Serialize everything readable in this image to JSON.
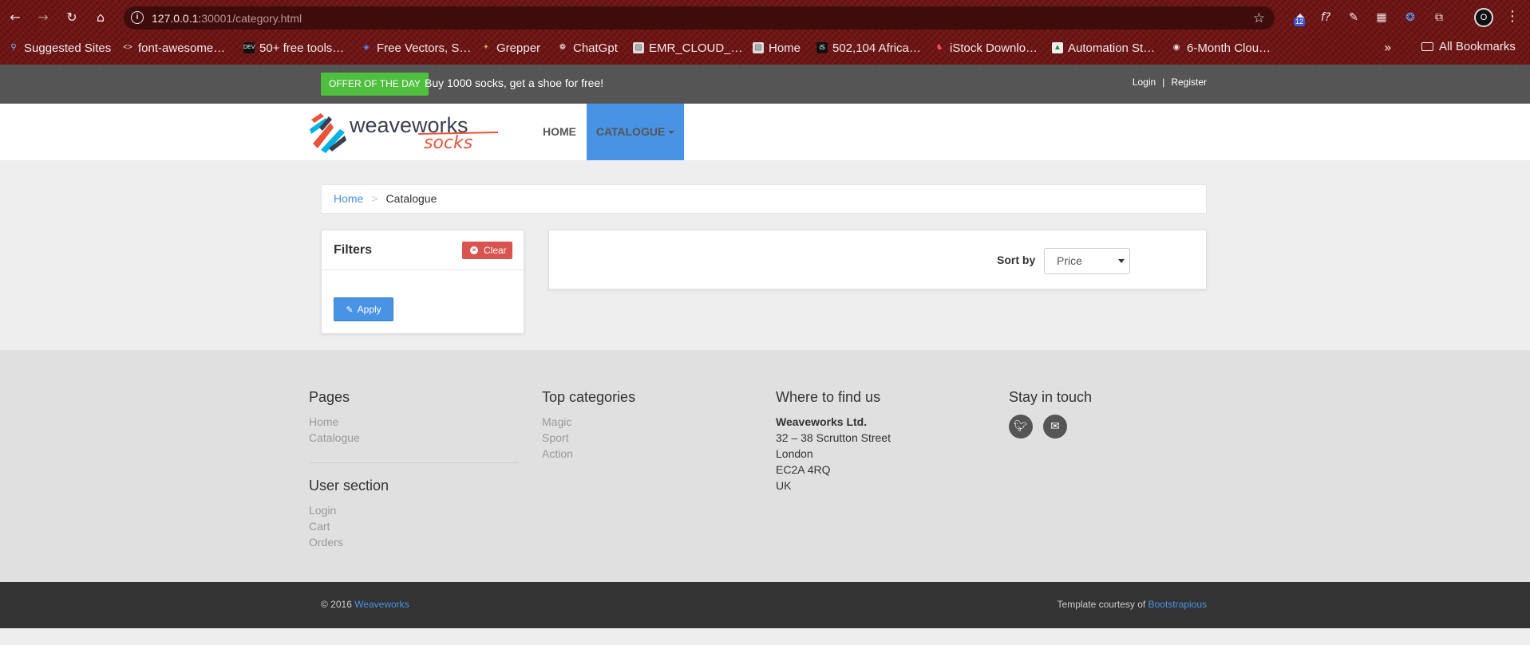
{
  "browser": {
    "url_host": "127.0.0.1:",
    "url_rest": "30001/category.html",
    "extension_badge": "12",
    "profile_initial": "O",
    "bookmarks": [
      {
        "label": "Suggested Sites",
        "icon": "search-icon"
      },
      {
        "label": "font-awesome…",
        "icon": "code-icon"
      },
      {
        "label": "50+ free tools…",
        "icon": "dev-icon"
      },
      {
        "label": "Free Vectors, S…",
        "icon": "shield-icon"
      },
      {
        "label": "Grepper",
        "icon": "grepper-icon"
      },
      {
        "label": "ChatGpt",
        "icon": "chatgpt-icon"
      },
      {
        "label": "EMR_CLOUD_…",
        "icon": "image-icon"
      },
      {
        "label": "Home",
        "icon": "image-icon"
      },
      {
        "label": "502,104 Africa…",
        "icon": "istock-icon"
      },
      {
        "label": "iStock Downlo…",
        "icon": "istock-icon"
      },
      {
        "label": "Automation St…",
        "icon": "triangle-icon"
      },
      {
        "label": "6-Month Clou…",
        "icon": "github-icon"
      }
    ],
    "all_bookmarks": "All Bookmarks"
  },
  "topbar": {
    "offer_badge": "OFFER OF THE DAY",
    "offer_text": "Buy 1000 socks, get a shoe for free!",
    "login": "Login",
    "separator": "|",
    "register": "Register"
  },
  "header": {
    "logo_main": "weaveworks",
    "logo_sub": "socks",
    "nav_home": "HOME",
    "nav_catalogue": "CATALOGUE"
  },
  "breadcrumb": {
    "home": "Home",
    "separator": ">",
    "current": "Catalogue"
  },
  "filters": {
    "title": "Filters",
    "clear": "Clear",
    "apply": "Apply"
  },
  "sort": {
    "label": "Sort by",
    "selected": "Price"
  },
  "footer": {
    "pages": {
      "title": "Pages",
      "links": [
        "Home",
        "Catalogue"
      ]
    },
    "user_section": {
      "title": "User section",
      "links": [
        "Login",
        "Cart",
        "Orders"
      ]
    },
    "top_categories": {
      "title": "Top categories",
      "links": [
        "Magic",
        "Sport",
        "Action"
      ]
    },
    "where": {
      "title": "Where to find us",
      "company": "Weaveworks Ltd.",
      "lines": [
        "32 – 38 Scrutton Street",
        "London",
        "EC2A 4RQ",
        "UK"
      ]
    },
    "stay": {
      "title": "Stay in touch",
      "icons": [
        "twitter-icon",
        "envelope-icon"
      ]
    }
  },
  "copyright": {
    "left_prefix": "© 2016 ",
    "left_link": "Weaveworks",
    "right_prefix": "Template courtesy of ",
    "right_link": "Bootstrapious"
  },
  "colors": {
    "primary_blue": "#4993e4",
    "offer_green": "#4fbf40",
    "clear_red": "#d9534f",
    "topbar_gray": "#555555",
    "footer_dark": "#333333"
  }
}
